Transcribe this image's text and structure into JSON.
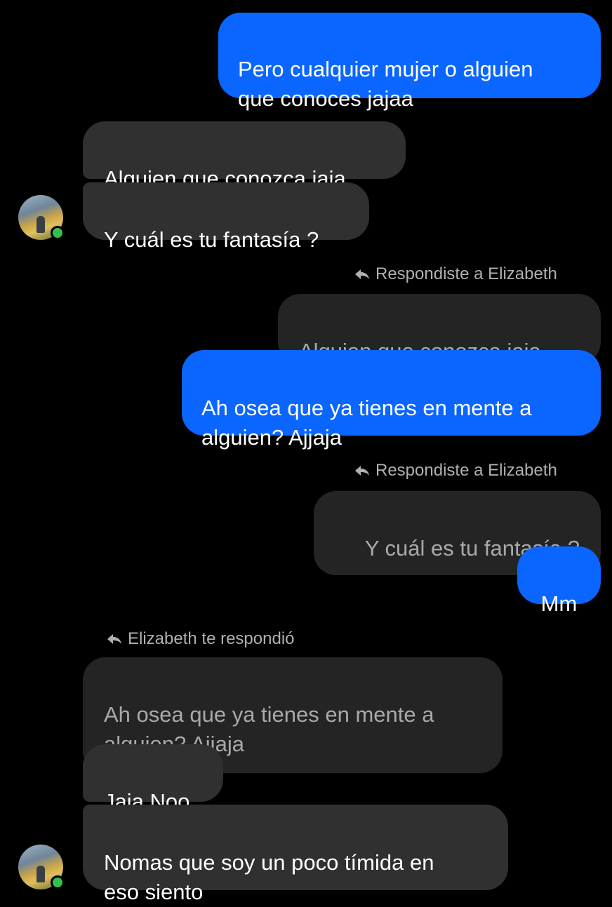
{
  "messages": {
    "m1": "Pero cualquier mujer o alguien\nque conoces jajaa",
    "m2": "Alguien que conozca jaja",
    "m3": "Y cuál es tu fantasía ?",
    "reply_label_1": "Respondiste a Elizabeth",
    "quote_1": "Alguien que conozca jaja",
    "m4": "Ah osea que ya tienes en mente a\nalguien? Ajjaja",
    "reply_label_2": "Respondiste a Elizabeth",
    "quote_2": "Y cuál es tu fantasía ?",
    "m5": "Mm",
    "reply_label_3": "Elizabeth te respondió",
    "quote_3": "Ah osea que ya tienes en mente a\nalguien? Ajjaja",
    "m6": "Jaja Noo",
    "m7": "Nomas que soy un poco tímida en\neso siento"
  },
  "icons": {
    "reply": "reply-arrow-icon",
    "avatar": "contact-avatar",
    "presence": "online-status-dot"
  },
  "colors": {
    "background": "#000000",
    "sent_bubble": "#0a66ff",
    "received_bubble": "#303030",
    "quoted_bubble": "#242424",
    "online": "#31c24d"
  }
}
